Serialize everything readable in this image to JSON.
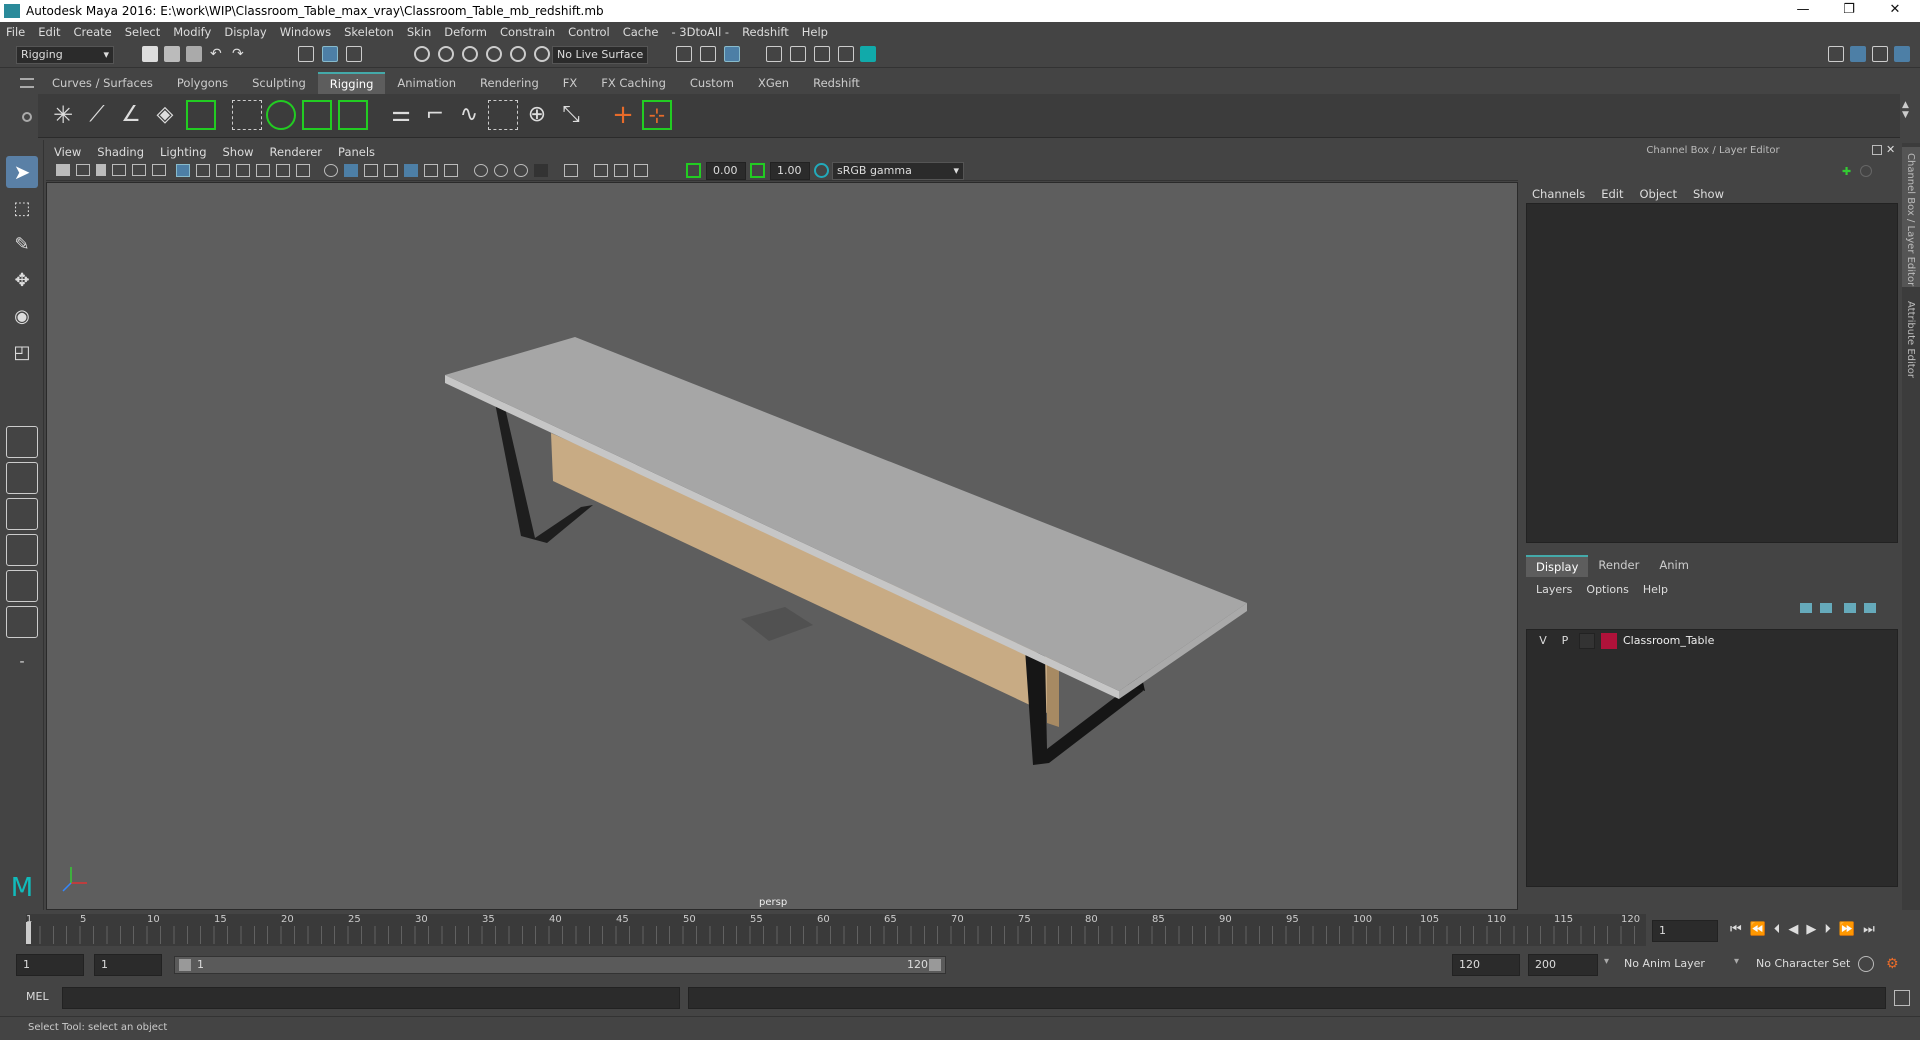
{
  "window": {
    "title": "Autodesk Maya 2016: E:\\work\\WIP\\Classroom_Table_max_vray\\Classroom_Table_mb_redshift.mb",
    "minimize": "—",
    "restore": "❐",
    "close": "✕"
  },
  "menubar": [
    "File",
    "Edit",
    "Create",
    "Select",
    "Modify",
    "Display",
    "Windows",
    "Skeleton",
    "Skin",
    "Deform",
    "Constrain",
    "Control",
    "Cache",
    "- 3DtoAll -",
    "Redshift",
    "Help"
  ],
  "statusline": {
    "menuset": "Rigging",
    "live_surface": "No Live Surface"
  },
  "shelf": {
    "tabs": [
      "Curves / Surfaces",
      "Polygons",
      "Sculpting",
      "Rigging",
      "Animation",
      "Rendering",
      "FX",
      "FX Caching",
      "Custom",
      "XGen",
      "Redshift"
    ],
    "active_tab": "Rigging"
  },
  "viewport": {
    "menus": [
      "View",
      "Shading",
      "Lighting",
      "Show",
      "Renderer",
      "Panels"
    ],
    "exposure": "0.00",
    "gamma": "1.00",
    "color_space": "sRGB gamma",
    "camera_label": "persp"
  },
  "channel_box": {
    "header": "Channel Box / Layer Editor",
    "menus": [
      "Channels",
      "Edit",
      "Object",
      "Show"
    ]
  },
  "layer_editor": {
    "tabs": [
      "Display",
      "Render",
      "Anim"
    ],
    "active_tab": "Display",
    "menus": [
      "Layers",
      "Options",
      "Help"
    ],
    "layers": [
      {
        "v": "V",
        "p": "P",
        "color": "#b0123a",
        "name": "Classroom_Table"
      }
    ]
  },
  "side_tabs": [
    "Channel Box / Layer Editor",
    "Attribute Editor"
  ],
  "timeline": {
    "ticks": [
      "1",
      "5",
      "10",
      "15",
      "20",
      "25",
      "30",
      "35",
      "40",
      "45",
      "50",
      "55",
      "60",
      "65",
      "70",
      "75",
      "80",
      "85",
      "90",
      "95",
      "100",
      "105",
      "110",
      "115",
      "120"
    ],
    "current_frame": "1"
  },
  "range": {
    "start": "1",
    "playback_start": "1",
    "slider_start": "1",
    "slider_end": "120",
    "playback_end": "120",
    "end": "200",
    "anim_layer": "No Anim Layer",
    "character_set": "No Character Set"
  },
  "command_line": {
    "language": "MEL"
  },
  "help_line": "Select Tool: select an object"
}
